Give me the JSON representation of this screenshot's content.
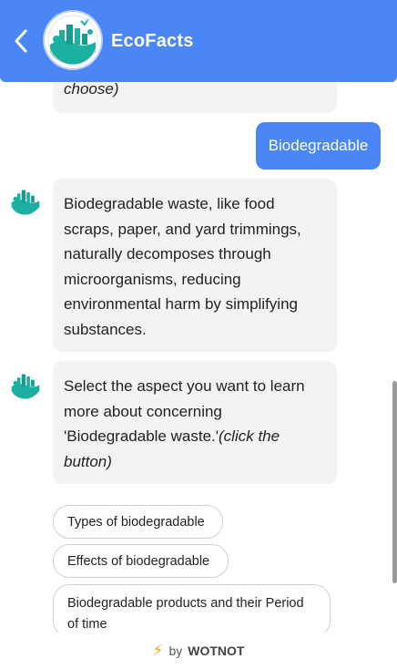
{
  "header": {
    "title": "EcoFacts",
    "back_icon": "chevron-left-icon",
    "avatar_icon": "eco-city-globe-icon",
    "bg_color": "#4a86f5"
  },
  "messages": [
    {
      "from": "bot",
      "text": "choose)"
    },
    {
      "from": "user",
      "text": "Biodegradable"
    },
    {
      "from": "bot",
      "text": "Biodegradable waste, like food scraps, paper, and yard trimmings, naturally decomposes through microorganisms, reducing environmental harm by simplifying substances."
    },
    {
      "from": "bot",
      "text_plain": "Select the aspect you want to learn more about concerning 'Biodegradable waste.'",
      "text_italic": "(click the button)"
    }
  ],
  "options": [
    "Types of biodegradable",
    "Effects of biodegradable",
    "Biodegradable products and their Period of time"
  ],
  "footer": {
    "prefix": "by",
    "brand": "WOTNOT",
    "icon": "lightning-bolt-icon"
  }
}
